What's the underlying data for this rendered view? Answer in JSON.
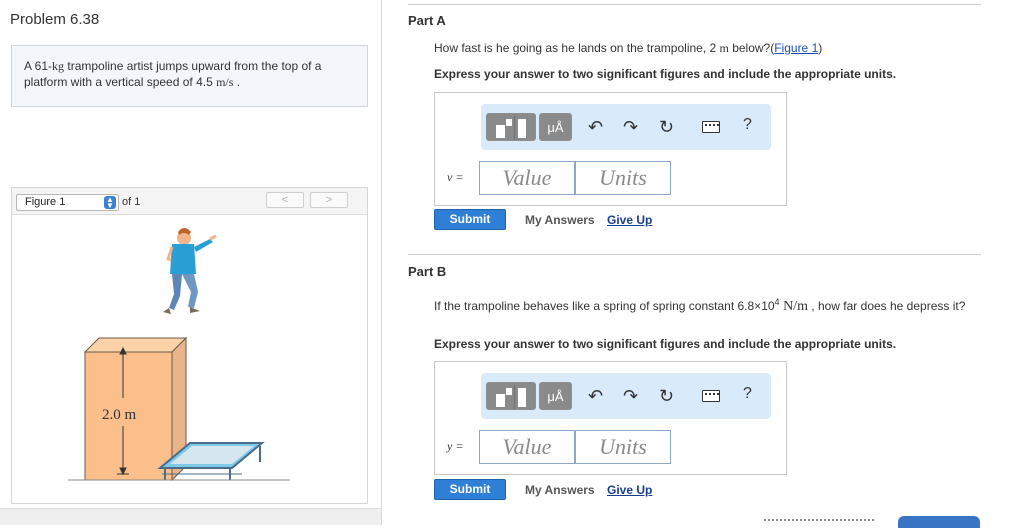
{
  "problem": {
    "title": "Problem 6.38",
    "statement_prefix": "A 61-",
    "statement_kg": "kg",
    "statement_middle": " trampoline artist jumps upward from the top of a platform with a vertical speed of 4.5 ",
    "statement_unit": "m/s",
    "statement_suffix": " ."
  },
  "figure": {
    "select_label": "Figure 1",
    "of_label": "of 1",
    "prev_label": "<",
    "next_label": ">",
    "height_label": "2.0 m"
  },
  "part_a": {
    "label": "Part A",
    "question_prefix": "How fast is he going as he lands on the trampoline, 2 ",
    "question_unit": "m",
    "question_middle": " below?(",
    "figure_link": "Figure 1",
    "question_suffix": ")",
    "instruction": "Express your answer to two significant figures and include the appropriate units.",
    "variable": "v =",
    "value_placeholder": "Value",
    "units_placeholder": "Units",
    "submit": "Submit",
    "my_answers": "My Answers",
    "give_up": "Give Up"
  },
  "part_b": {
    "label": "Part B",
    "question_prefix": "If the trampoline behaves like a spring of spring constant 6.8×10",
    "question_exp": "4",
    "question_unit": " N/m",
    "question_suffix": " , how far does he depress it?",
    "instruction": "Express your answer to two significant figures and include the appropriate units.",
    "variable": "y =",
    "value_placeholder": "Value",
    "units_placeholder": "Units",
    "submit": "Submit",
    "my_answers": "My Answers",
    "give_up": "Give Up"
  },
  "toolbar": {
    "mu_label": "μÅ",
    "undo": "↶",
    "redo": "↷",
    "reset": "↻",
    "help": "?"
  }
}
